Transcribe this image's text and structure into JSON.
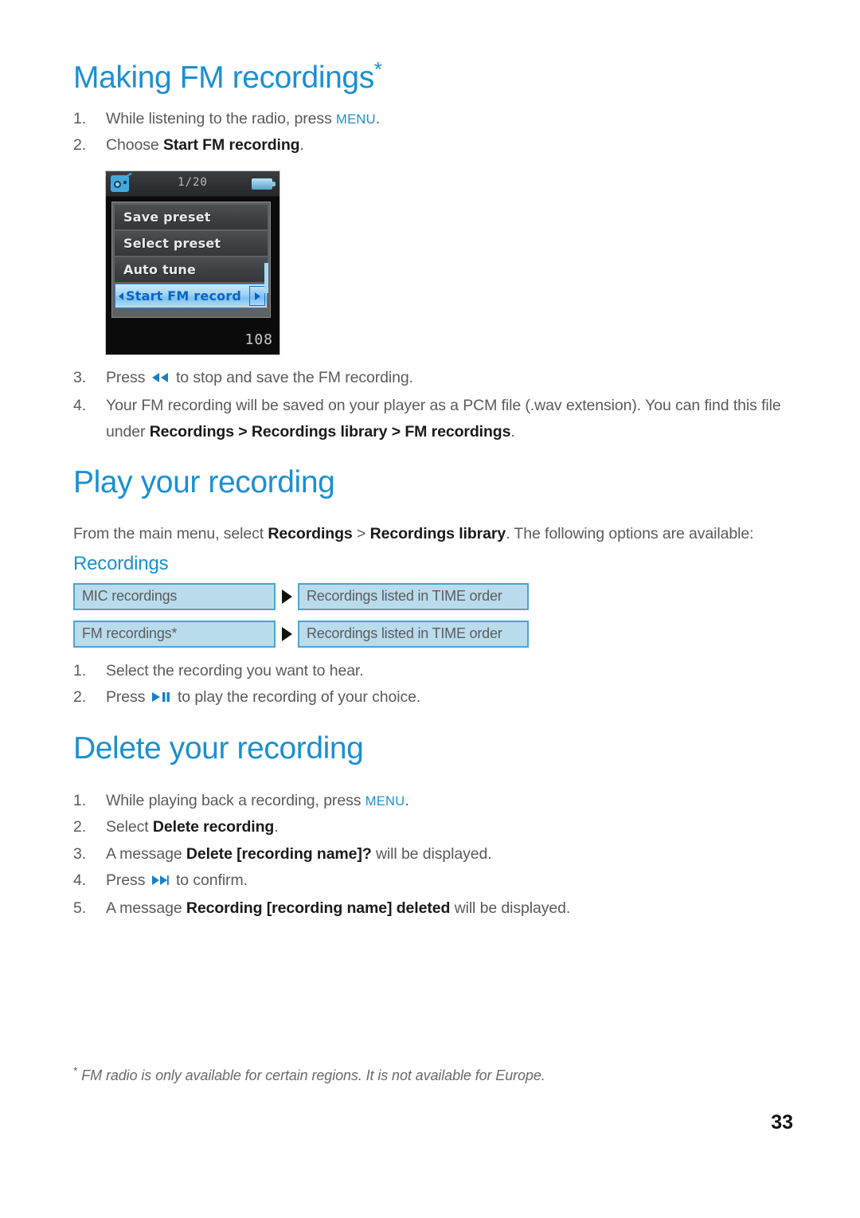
{
  "document": {
    "page_number": "33",
    "footnote_marker": "*",
    "footnote": "FM radio is only available for certain regions. It is not available for Europe."
  },
  "sections": [
    {
      "title": "Making FM recordings",
      "title_asterisk": "*",
      "steps": [
        {
          "num": "1.",
          "parts": [
            {
              "text": "While listening to the radio, press ",
              "style": "plain"
            },
            {
              "text": "MENU",
              "style": "menu-kw"
            },
            {
              "text": ".",
              "style": "plain"
            }
          ]
        },
        {
          "num": "2.",
          "parts": [
            {
              "text": "Choose ",
              "style": "plain"
            },
            {
              "text": "Start FM recording",
              "style": "bold"
            },
            {
              "text": ".",
              "style": "plain"
            }
          ]
        },
        {
          "num": "3.",
          "parts": [
            {
              "text": "Press ",
              "style": "plain"
            },
            {
              "text": "",
              "style": "icon",
              "icon": "rewind-icon"
            },
            {
              "text": " to stop and save the FM recording.",
              "style": "plain"
            }
          ]
        },
        {
          "num": "4.",
          "parts": [
            {
              "text": "Your FM recording will be saved on your player as a PCM file (.wav extension). You can find this file under ",
              "style": "plain"
            },
            {
              "text": "Recordings > Recordings library > FM recordings",
              "style": "bold"
            },
            {
              "text": ".",
              "style": "plain"
            }
          ]
        }
      ]
    },
    {
      "title": "Play your recording",
      "intro": [
        {
          "text": "From the main menu, select ",
          "style": "plain"
        },
        {
          "text": "Recordings",
          "style": "bold"
        },
        {
          "text": " > ",
          "style": "plain"
        },
        {
          "text": "Recordings library",
          "style": "bold"
        },
        {
          "text": ". The following options are available:",
          "style": "plain"
        }
      ],
      "subtitle": "Recordings",
      "flow_rows": [
        {
          "left": "MIC recordings",
          "right": "Recordings listed in TIME order"
        },
        {
          "left": "FM recordings*",
          "right": "Recordings listed in TIME order"
        }
      ],
      "steps": [
        {
          "num": "1.",
          "parts": [
            {
              "text": "Select the recording you want to hear.",
              "style": "plain"
            }
          ]
        },
        {
          "num": "2.",
          "parts": [
            {
              "text": "Press ",
              "style": "plain"
            },
            {
              "text": "",
              "style": "icon",
              "icon": "play-pause-icon"
            },
            {
              "text": " to play the recording of your choice.",
              "style": "plain"
            }
          ]
        }
      ]
    },
    {
      "title": "Delete your recording",
      "steps": [
        {
          "num": "1.",
          "parts": [
            {
              "text": "While playing back a recording, press ",
              "style": "plain"
            },
            {
              "text": "MENU",
              "style": "menu-kw"
            },
            {
              "text": ".",
              "style": "plain"
            }
          ]
        },
        {
          "num": "2.",
          "parts": [
            {
              "text": "Select ",
              "style": "plain"
            },
            {
              "text": "Delete recording",
              "style": "bold"
            },
            {
              "text": ".",
              "style": "plain"
            }
          ]
        },
        {
          "num": "3.",
          "parts": [
            {
              "text": "A message ",
              "style": "plain"
            },
            {
              "text": "Delete [recording name]?",
              "style": "bold"
            },
            {
              "text": " will be displayed.",
              "style": "plain"
            }
          ]
        },
        {
          "num": "4.",
          "parts": [
            {
              "text": "Press ",
              "style": "plain"
            },
            {
              "text": "",
              "style": "icon",
              "icon": "fast-forward-icon"
            },
            {
              "text": " to confirm.",
              "style": "plain"
            }
          ]
        },
        {
          "num": "5.",
          "parts": [
            {
              "text": "A message ",
              "style": "plain"
            },
            {
              "text": "Recording [recording name] deleted",
              "style": "bold"
            },
            {
              "text": " will be displayed.",
              "style": "plain"
            }
          ]
        }
      ]
    }
  ],
  "device_screenshot": {
    "status_bar": {
      "radio_icon": "fm-radio-icon",
      "page_indicator": "1/20",
      "battery_icon": "battery-icon"
    },
    "menu_items": [
      {
        "label": "Save preset",
        "selected": false
      },
      {
        "label": "Select preset",
        "selected": false
      },
      {
        "label": "Auto tune",
        "selected": false
      },
      {
        "label": "Start FM record",
        "selected": true
      }
    ],
    "frequency": "108"
  },
  "colors": {
    "heading_blue": "#1b8fd2",
    "box_fill": "#b9dcec",
    "box_border": "#4ba4cf",
    "body_text": "#5a5a5a",
    "bold_text": "#1a1a1a"
  }
}
